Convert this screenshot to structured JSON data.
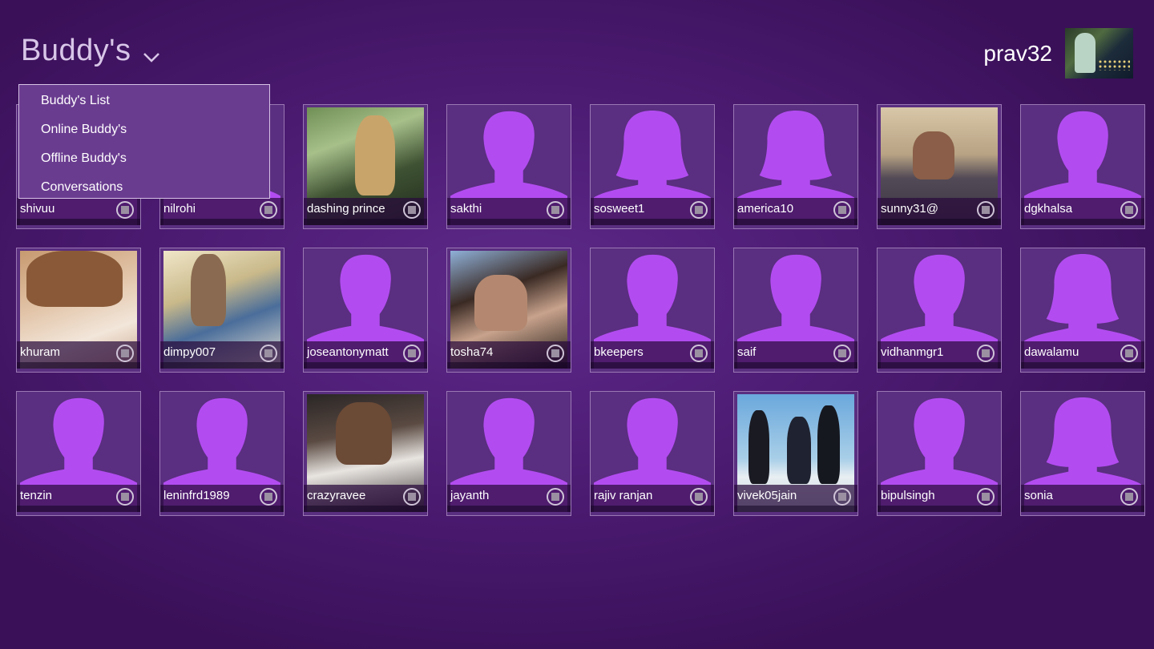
{
  "header": {
    "title": "Buddy's"
  },
  "user": {
    "name": "prav32"
  },
  "dropdown": {
    "items": [
      {
        "label": "Buddy's List"
      },
      {
        "label": "Online Buddy's"
      },
      {
        "label": "Offline Buddy's"
      },
      {
        "label": "Conversations"
      }
    ]
  },
  "colors": {
    "background": "#4a1a70",
    "silhouette": "#b24cf0",
    "tile_bg": "#5a2e80",
    "menu_bg": "#6a3c90"
  },
  "buddies": [
    {
      "name": "shivuu",
      "avatar": "default-male"
    },
    {
      "name": "nilrohi",
      "avatar": "default-male"
    },
    {
      "name": "dashing prince",
      "avatar": "photo"
    },
    {
      "name": "sakthi",
      "avatar": "default-male"
    },
    {
      "name": "sosweet1",
      "avatar": "default-female"
    },
    {
      "name": "america10",
      "avatar": "default-female"
    },
    {
      "name": "sunny31@",
      "avatar": "photo"
    },
    {
      "name": "dgkhalsa",
      "avatar": "default-male"
    },
    {
      "name": "khuram",
      "avatar": "photo"
    },
    {
      "name": "dimpy007",
      "avatar": "photo"
    },
    {
      "name": "joseantonymatt",
      "avatar": "default-male"
    },
    {
      "name": "tosha74",
      "avatar": "photo"
    },
    {
      "name": "bkeepers",
      "avatar": "default-male"
    },
    {
      "name": "saif",
      "avatar": "default-male"
    },
    {
      "name": "vidhanmgr1",
      "avatar": "default-male"
    },
    {
      "name": "dawalamu",
      "avatar": "default-female"
    },
    {
      "name": "tenzin",
      "avatar": "default-male"
    },
    {
      "name": "leninfrd1989",
      "avatar": "default-male"
    },
    {
      "name": "crazyravee",
      "avatar": "photo"
    },
    {
      "name": "jayanth",
      "avatar": "default-male"
    },
    {
      "name": "rajiv ranjan",
      "avatar": "default-male"
    },
    {
      "name": "vivek05jain",
      "avatar": "photo"
    },
    {
      "name": "bipulsingh",
      "avatar": "default-male"
    },
    {
      "name": "sonia",
      "avatar": "default-female"
    }
  ]
}
